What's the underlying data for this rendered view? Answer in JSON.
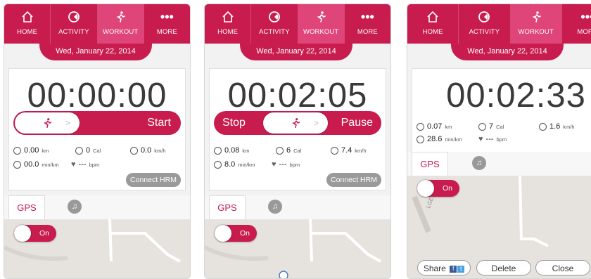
{
  "nav": [
    "HOME",
    "ACTIVITY",
    "WORKOUT",
    "MORE"
  ],
  "date": "Wed, January 22, 2014",
  "colors": {
    "accent": "#c81c4f",
    "active_tab": "#e0457a"
  },
  "icons": {
    "home": "home-icon",
    "activity": "activity-icon",
    "workout": "runner-icon",
    "more": "more-dots-icon"
  },
  "units": {
    "km": "km",
    "cal": "Cal",
    "kmh": "km/h",
    "pace": "min/km",
    "bpm": "bpm"
  },
  "tabs": {
    "gps": "GPS"
  },
  "toggle_on": "On",
  "screens": [
    {
      "timer": "00:00:00",
      "start": "Start",
      "distance": "0.00",
      "calories": "0",
      "speed": "0.0",
      "pace": "00.0",
      "heart": "---",
      "hrm": "Connect HRM"
    },
    {
      "timer": "00:02:05",
      "stop": "Stop",
      "pause": "Pause",
      "distance": "0.08",
      "calories": "6",
      "speed": "7.4",
      "pace": "8.0",
      "heart": "---",
      "hrm": "Connect HRM"
    },
    {
      "timer": "00:02:33",
      "distance": "0.07",
      "calories": "7",
      "speed": "1.6",
      "pace": "28.6",
      "heart": "---",
      "share": "Share",
      "delete": "Delete",
      "close": "Close",
      "map_label": "LGE"
    }
  ]
}
